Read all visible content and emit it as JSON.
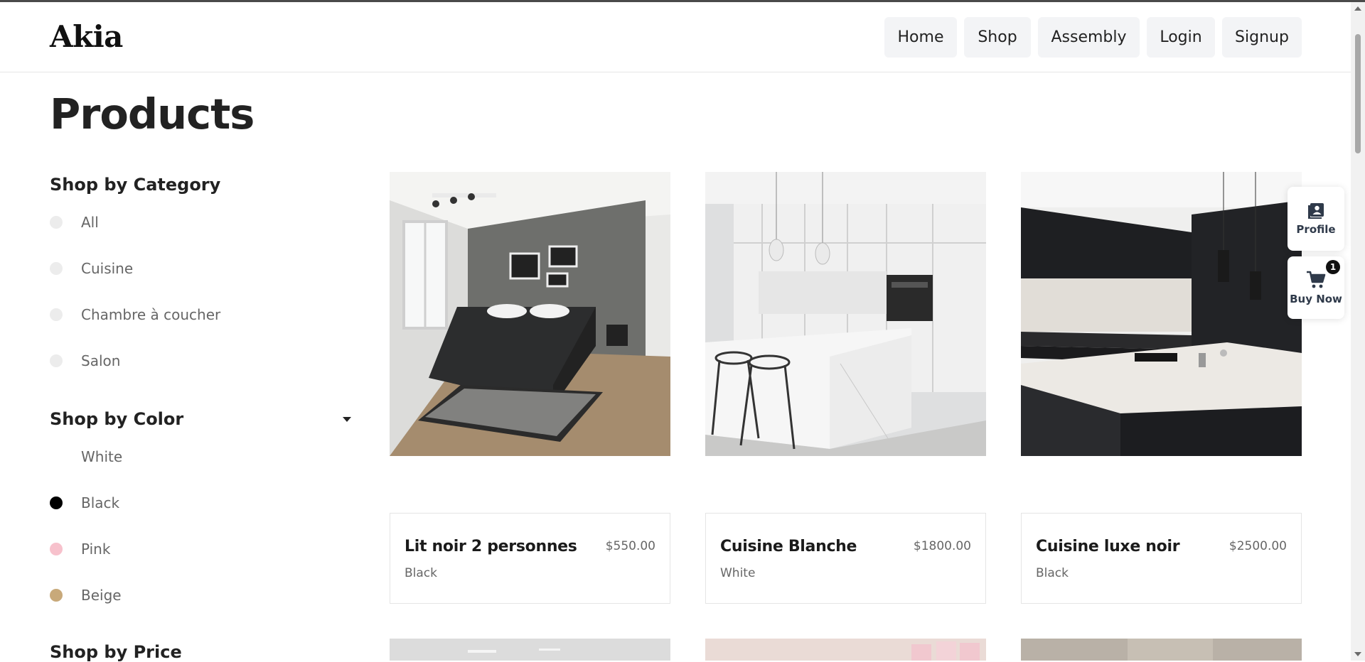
{
  "header": {
    "logo": "Akia",
    "nav": [
      "Home",
      "Shop",
      "Assembly",
      "Login",
      "Signup"
    ]
  },
  "page_title": "Products",
  "sidebar": {
    "category_heading": "Shop by Category",
    "categories": [
      "All",
      "Cuisine",
      "Chambre à coucher",
      "Salon"
    ],
    "color_heading": "Shop by Color",
    "colors": [
      {
        "label": "White",
        "swatch": "#ffffff"
      },
      {
        "label": "Black",
        "swatch": "#000000"
      },
      {
        "label": "Pink",
        "swatch": "#f7c1cc"
      },
      {
        "label": "Beige",
        "swatch": "#c8a97a"
      }
    ],
    "price_heading": "Shop by Price"
  },
  "products": [
    {
      "name": "Lit noir 2 personnes",
      "price": "$550.00",
      "color": "Black"
    },
    {
      "name": "Cuisine Blanche",
      "price": "$1800.00",
      "color": "White"
    },
    {
      "name": "Cuisine luxe noir",
      "price": "$2500.00",
      "color": "Black"
    }
  ],
  "floating": {
    "profile_label": "Profile",
    "cart_label": "Buy Now",
    "cart_count": "1"
  }
}
